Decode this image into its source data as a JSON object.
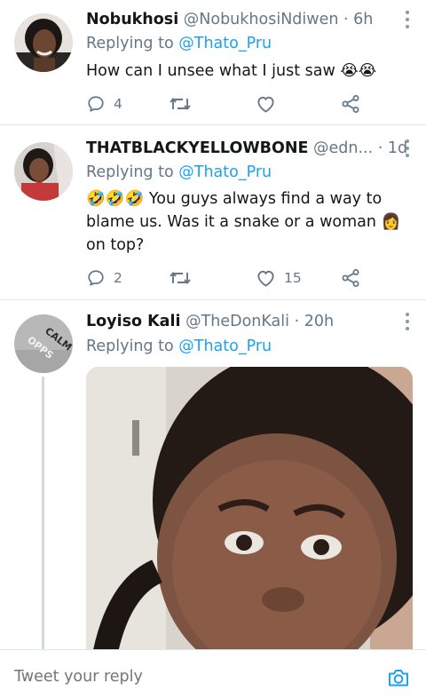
{
  "tweets": [
    {
      "name": "Nobukhosi",
      "handle": "@NobukhosiNdiwen",
      "time": "· 6h",
      "replying_prefix": "Replying to",
      "replying_to": "@Thato_Pru",
      "text": "How can I unsee what I just saw 😭😭",
      "reply_count": "4",
      "retweet_count": "",
      "like_count": ""
    },
    {
      "name": "THATBLACKYELLOWBONE",
      "handle": "@edn...",
      "time": "· 1d",
      "replying_prefix": "Replying to",
      "replying_to": "@Thato_Pru",
      "text": "🤣🤣🤣  You guys always find a way to blame us. Was it a snake or a woman 👩 on top?",
      "reply_count": "2",
      "retweet_count": "",
      "like_count": "15"
    },
    {
      "name": "Loyiso Kali",
      "handle": "@TheDonKali",
      "time": "· 20h",
      "replying_prefix": "Replying to",
      "replying_to": "@Thato_Pru",
      "avatar_text_1": "CALM",
      "avatar_text_2": "OPPS"
    }
  ],
  "composer": {
    "placeholder": "Tweet your reply"
  },
  "icons": {
    "reply": "reply-icon",
    "retweet": "retweet-icon",
    "like": "heart-icon",
    "share": "share-icon",
    "more": "more-vertical-icon",
    "camera": "camera-icon"
  },
  "colors": {
    "accent": "#1da1f2",
    "muted": "#657786",
    "text": "#14171a",
    "divider": "#e1e8ed"
  }
}
